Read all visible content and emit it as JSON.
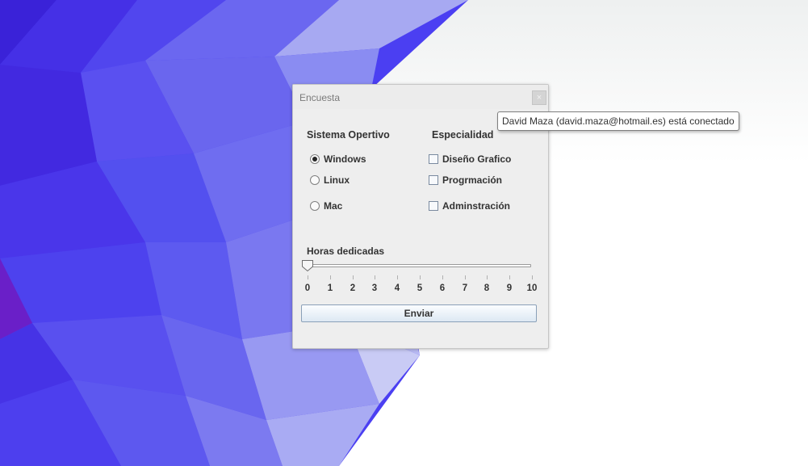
{
  "window": {
    "title": "Encuesta",
    "close_glyph": "×"
  },
  "sections": {
    "os_heading": "Sistema Opertivo",
    "specialty_heading": "Especialidad",
    "hours_heading": "Horas dedicadas"
  },
  "os_options": [
    {
      "label": "Windows",
      "selected": true
    },
    {
      "label": "Linux",
      "selected": false
    },
    {
      "label": "Mac",
      "selected": false
    }
  ],
  "specialty_options": [
    {
      "label": "Diseño Grafico",
      "checked": false
    },
    {
      "label": "Progrmación",
      "checked": false
    },
    {
      "label": "Adminstración",
      "checked": false
    }
  ],
  "slider": {
    "min": 0,
    "max": 10,
    "value": 0,
    "tick_labels": [
      "0",
      "1",
      "2",
      "3",
      "4",
      "5",
      "6",
      "7",
      "8",
      "9",
      "10"
    ]
  },
  "send_button": {
    "label": "Enviar"
  },
  "tooltip": {
    "text": "David Maza (david.maza@hotmail.es) está conectado"
  },
  "colors": {
    "desktop_blue": "#4a3df0",
    "window_bg": "#eeeeee",
    "tooltip_border": "#7f7f7f"
  }
}
